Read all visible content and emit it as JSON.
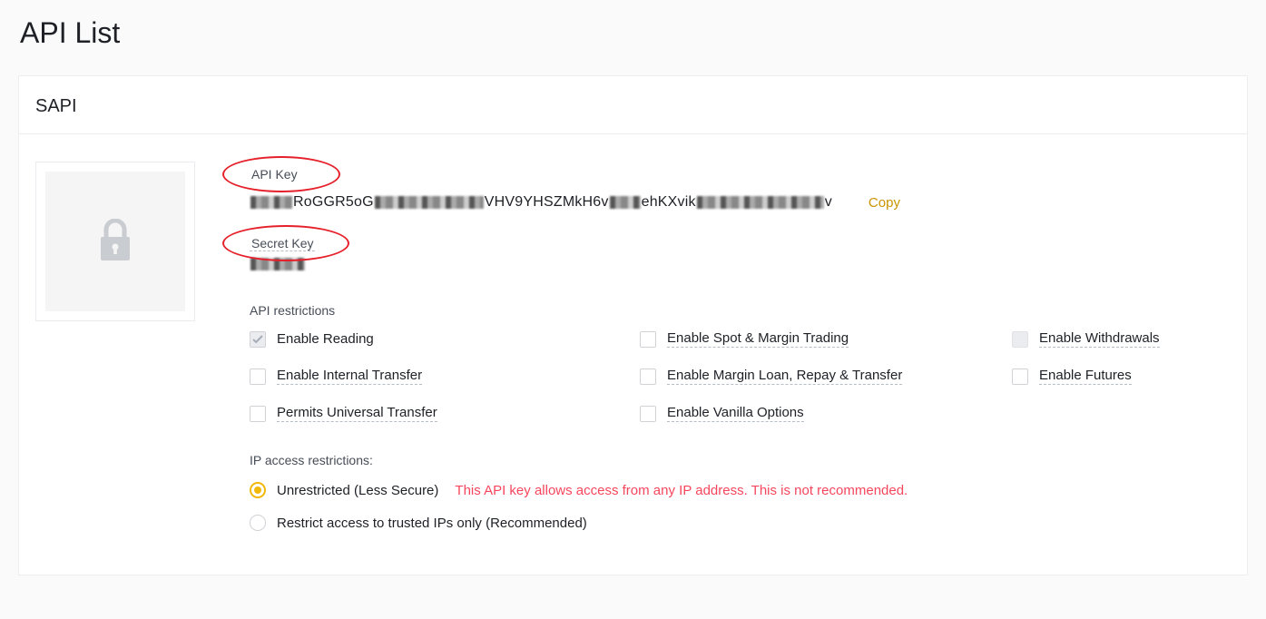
{
  "page_title": "API List",
  "api_name": "SAPI",
  "api_key": {
    "label": "API Key",
    "value_frag1": "RoGGR5oG",
    "value_frag2": "VHV9YHSZMkH6v",
    "value_frag3": "ehKXvik",
    "value_frag4": "v",
    "copy_label": "Copy"
  },
  "secret_key": {
    "label": "Secret Key"
  },
  "restrictions": {
    "section_label": "API restrictions",
    "items": [
      {
        "label": "Enable Reading",
        "checked": true,
        "disabled": true,
        "dashed": false
      },
      {
        "label": "Enable Spot & Margin Trading",
        "checked": false,
        "disabled": false,
        "dashed": true
      },
      {
        "label": "Enable Withdrawals",
        "checked": false,
        "disabled": true,
        "dashed": true
      },
      {
        "label": "Enable Internal Transfer",
        "checked": false,
        "disabled": false,
        "dashed": true
      },
      {
        "label": "Enable Margin Loan, Repay & Transfer",
        "checked": false,
        "disabled": false,
        "dashed": true
      },
      {
        "label": "Enable Futures",
        "checked": false,
        "disabled": false,
        "dashed": true
      },
      {
        "label": "Permits Universal Transfer",
        "checked": false,
        "disabled": false,
        "dashed": true
      },
      {
        "label": "Enable Vanilla Options",
        "checked": false,
        "disabled": false,
        "dashed": true
      }
    ]
  },
  "ip_access": {
    "section_label": "IP access restrictions:",
    "options": [
      {
        "label": "Unrestricted (Less Secure)",
        "selected": true,
        "warning": "This API key allows access from any IP address. This is not recommended."
      },
      {
        "label": "Restrict access to trusted IPs only (Recommended)",
        "selected": false,
        "warning": ""
      }
    ]
  }
}
